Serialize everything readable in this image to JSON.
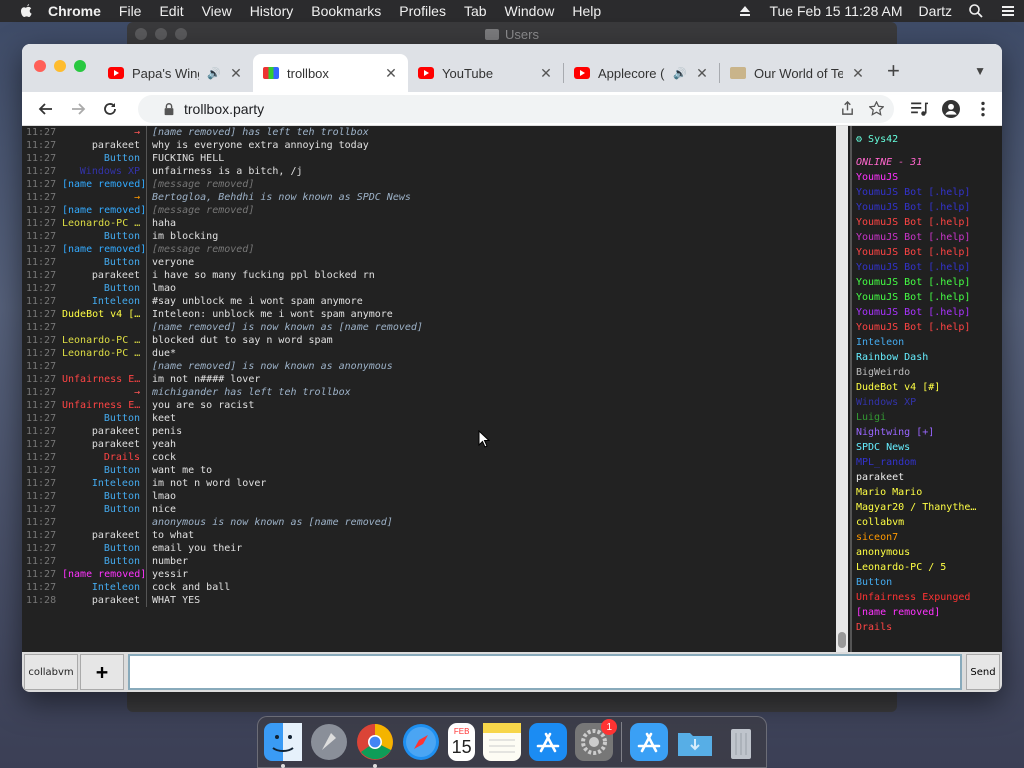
{
  "menubar": {
    "app": "Chrome",
    "items": [
      "File",
      "Edit",
      "View",
      "History",
      "Bookmarks",
      "Profiles",
      "Tab",
      "Window",
      "Help"
    ],
    "datetime": "Tue Feb 15  11:28 AM",
    "user": "Dartz"
  },
  "background_window": {
    "title": "Users"
  },
  "chrome": {
    "tabs": [
      {
        "title": "Papa's Wing",
        "favicon": "youtube-icon",
        "audio": true,
        "active": false
      },
      {
        "title": "trollbox",
        "favicon": "trollbox-icon",
        "audio": false,
        "active": true
      },
      {
        "title": "YouTube",
        "favicon": "youtube-icon",
        "audio": false,
        "active": false
      },
      {
        "title": "Applecore (",
        "favicon": "youtube-icon",
        "audio": true,
        "active": false
      },
      {
        "title": "Our World of Te",
        "favicon": "web-icon",
        "audio": false,
        "active": false
      }
    ],
    "url": "trollbox.party"
  },
  "chat": {
    "messages": [
      {
        "time": "11:27",
        "nick": "→",
        "nick_color": "#f55",
        "body": "[name removed] has left teh trollbox",
        "system": true
      },
      {
        "time": "11:27",
        "nick": "parakeet",
        "nick_color": "#ddd",
        "body": "why is everyone extra annoying today"
      },
      {
        "time": "11:27",
        "nick": "Button",
        "nick_color": "#4ae",
        "body": "FUCKING HELL"
      },
      {
        "time": "11:27",
        "nick": "Windows XP",
        "nick_color": "#33a",
        "body": "unfairness is a bitch, /j"
      },
      {
        "time": "11:27",
        "nick": "[name removed]",
        "nick_color": "#3af",
        "body": "[message removed]",
        "removed": true
      },
      {
        "time": "11:27",
        "nick": "→",
        "nick_color": "#f90",
        "body": "Bertogloa, Behdhi is now known as SPDC News",
        "system": true
      },
      {
        "time": "11:27",
        "nick": "[name removed]",
        "nick_color": "#3af",
        "body": "[message removed]",
        "removed": true
      },
      {
        "time": "11:27",
        "nick": "Leonardo-PC …",
        "nick_color": "#dd4",
        "body": "haha"
      },
      {
        "time": "11:27",
        "nick": "Button",
        "nick_color": "#4ae",
        "body": "im blocking"
      },
      {
        "time": "11:27",
        "nick": "[name removed]",
        "nick_color": "#3af",
        "body": "[message removed]",
        "removed": true
      },
      {
        "time": "11:27",
        "nick": "Button",
        "nick_color": "#4ae",
        "body": "veryone"
      },
      {
        "time": "11:27",
        "nick": "parakeet",
        "nick_color": "#ddd",
        "body": "i have so many fucking ppl blocked rn"
      },
      {
        "time": "11:27",
        "nick": "Button",
        "nick_color": "#4ae",
        "body": "lmao"
      },
      {
        "time": "11:27",
        "nick": "Inteleon",
        "nick_color": "#4ae",
        "body": "#say unblock me i wont spam anymore"
      },
      {
        "time": "11:27",
        "nick": "DudeBot v4 […",
        "nick_color": "#ff4",
        "body": "Inteleon: unblock me i wont spam anymore"
      },
      {
        "time": "11:27",
        "nick": "",
        "nick_color": "#9db",
        "body": "[name removed] is now known as [name removed]",
        "system": true
      },
      {
        "time": "11:27",
        "nick": "Leonardo-PC …",
        "nick_color": "#dd4",
        "body": "blocked dut to say n word spam"
      },
      {
        "time": "11:27",
        "nick": "Leonardo-PC …",
        "nick_color": "#dd4",
        "body": "due*"
      },
      {
        "time": "11:27",
        "nick": "",
        "nick_color": "#9db",
        "body": "[name removed] is now known as anonymous",
        "system": true
      },
      {
        "time": "11:27",
        "nick": "Unfairness E…",
        "nick_color": "#f44",
        "body": "im not n#### lover"
      },
      {
        "time": "11:27",
        "nick": "→",
        "nick_color": "#f55",
        "body": "michigander has left teh trollbox",
        "system": true
      },
      {
        "time": "11:27",
        "nick": "Unfairness E…",
        "nick_color": "#f44",
        "body": "you are so racist"
      },
      {
        "time": "11:27",
        "nick": "Button",
        "nick_color": "#4ae",
        "body": "keet"
      },
      {
        "time": "11:27",
        "nick": "parakeet",
        "nick_color": "#ddd",
        "body": "penis"
      },
      {
        "time": "11:27",
        "nick": "parakeet",
        "nick_color": "#ddd",
        "body": "yeah"
      },
      {
        "time": "11:27",
        "nick": "Drails",
        "nick_color": "#f44",
        "body": "cock"
      },
      {
        "time": "11:27",
        "nick": "Button",
        "nick_color": "#4ae",
        "body": "want me to"
      },
      {
        "time": "11:27",
        "nick": "Inteleon",
        "nick_color": "#4ae",
        "body": "im not n word lover"
      },
      {
        "time": "11:27",
        "nick": "Button",
        "nick_color": "#4ae",
        "body": "lmao"
      },
      {
        "time": "11:27",
        "nick": "Button",
        "nick_color": "#4ae",
        "body": "nice"
      },
      {
        "time": "11:27",
        "nick": "",
        "nick_color": "#9db",
        "body": "anonymous is now known as [name removed]",
        "system": true
      },
      {
        "time": "11:27",
        "nick": "parakeet",
        "nick_color": "#ddd",
        "body": "to what"
      },
      {
        "time": "11:27",
        "nick": "Button",
        "nick_color": "#4ae",
        "body": "email you their"
      },
      {
        "time": "11:27",
        "nick": "Button",
        "nick_color": "#4ae",
        "body": "number"
      },
      {
        "time": "11:27",
        "nick": "[name removed]",
        "nick_color": "#f3f",
        "body": "yessir"
      },
      {
        "time": "11:27",
        "nick": "Inteleon",
        "nick_color": "#4ae",
        "body": "cock and ball"
      },
      {
        "time": "11:28",
        "nick": "parakeet",
        "nick_color": "#ddd",
        "body": "WHAT YES"
      }
    ]
  },
  "userlist": {
    "top_user": "Sys42",
    "online_label": "ONLINE - 31",
    "users": [
      {
        "name": "YoumuJS",
        "color": "#f3f"
      },
      {
        "name": "YoumuJS Bot [.help]",
        "color": "#33c"
      },
      {
        "name": "YoumuJS Bot [.help]",
        "color": "#33c"
      },
      {
        "name": "YoumuJS Bot [.help]",
        "color": "#f44"
      },
      {
        "name": "YoumuJS Bot [.help]",
        "color": "#c3c"
      },
      {
        "name": "YoumuJS Bot [.help]",
        "color": "#f44"
      },
      {
        "name": "YoumuJS Bot [.help]",
        "color": "#33c"
      },
      {
        "name": "YoumuJS Bot [.help]",
        "color": "#4f4"
      },
      {
        "name": "YoumuJS Bot [.help]",
        "color": "#4f4"
      },
      {
        "name": "YoumuJS Bot [.help]",
        "color": "#a3f"
      },
      {
        "name": "YoumuJS Bot [.help]",
        "color": "#f44"
      },
      {
        "name": "Inteleon",
        "color": "#4ae"
      },
      {
        "name": "Rainbow Dash",
        "color": "#6ef"
      },
      {
        "name": "BigWeirdo",
        "color": "#bbb"
      },
      {
        "name": "DudeBot v4 [#]",
        "color": "#ff4"
      },
      {
        "name": "Windows XP",
        "color": "#33a"
      },
      {
        "name": "Luigi",
        "color": "#393"
      },
      {
        "name": "Nightwing [+]",
        "color": "#96f"
      },
      {
        "name": "SPDC News",
        "color": "#6ef"
      },
      {
        "name": "MPL_random",
        "color": "#33c"
      },
      {
        "name": "parakeet",
        "color": "#eee"
      },
      {
        "name": "Mario Mario",
        "color": "#ff4"
      },
      {
        "name": "Magyar20 / Thanythe…",
        "color": "#ff4"
      },
      {
        "name": "collabvm",
        "color": "#ff4"
      },
      {
        "name": "siceon7",
        "color": "#f90"
      },
      {
        "name": "anonymous",
        "color": "#ff4"
      },
      {
        "name": "Leonardo-PC / 5",
        "color": "#ff4"
      },
      {
        "name": "Button",
        "color": "#4ae"
      },
      {
        "name": "Unfairness Expunged",
        "color": "#f33"
      },
      {
        "name": "[name removed]",
        "color": "#f3f"
      },
      {
        "name": "Drails",
        "color": "#f44"
      }
    ]
  },
  "input": {
    "room_label": "collabvm",
    "plus_label": "+",
    "send_label": "Send",
    "value": ""
  },
  "dock": {
    "apps": [
      "finder-icon",
      "launchpad-icon",
      "chrome-icon",
      "safari-icon",
      "calendar-icon",
      "notes-icon",
      "app-store-icon",
      "system-preferences-icon",
      "app-store-icon",
      "downloads-folder-icon",
      "trash-icon"
    ],
    "calendar_month": "FEB",
    "calendar_day": "15",
    "settings_badge": "1"
  }
}
